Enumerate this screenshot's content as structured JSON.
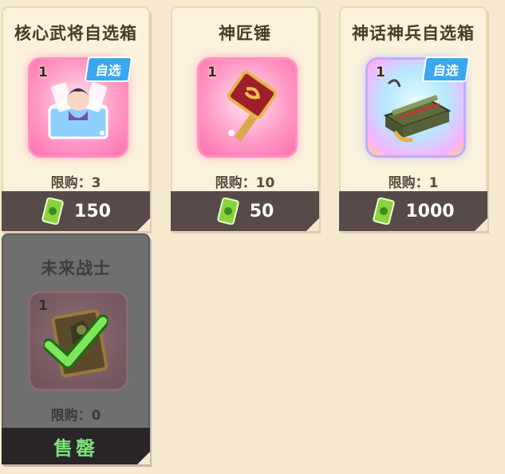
{
  "items": [
    {
      "name": "核心武将自选箱",
      "qty": "1",
      "badge": "自选",
      "limit": "限购：3",
      "price": "150"
    },
    {
      "name": "神匠锤",
      "qty": "1",
      "limit": "限购：10",
      "price": "50"
    },
    {
      "name": "神话神兵自选箱",
      "qty": "1",
      "badge": "自选",
      "limit": "限购：1",
      "price": "1000"
    },
    {
      "name": "未来战士",
      "qty": "1",
      "limit": "限购：0",
      "status": "售罄"
    }
  ],
  "icons": {
    "currency": "green-ticket-icon",
    "sold_mark": "green-check-icon"
  },
  "colors": {
    "background": "#f7e9cf",
    "price_bar": "#574a49",
    "badge": "#3aa7ef",
    "sold_text": "#7ee07a"
  }
}
